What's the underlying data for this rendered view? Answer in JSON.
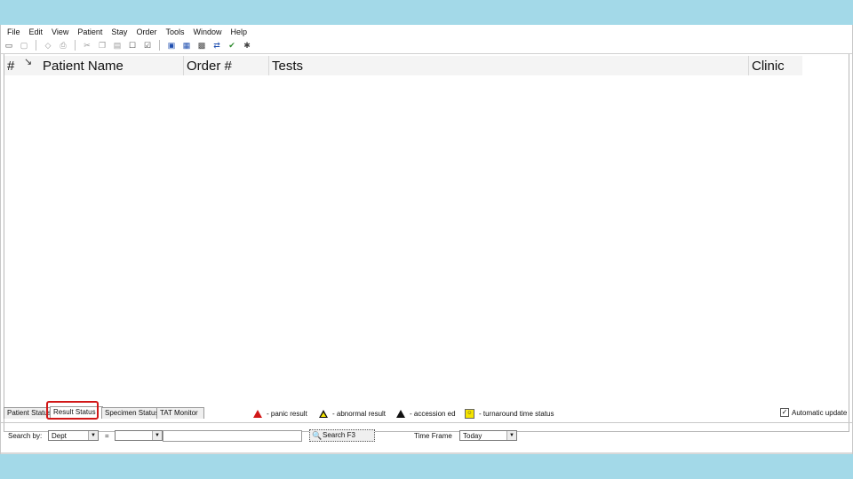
{
  "menu": [
    "File",
    "Edit",
    "View",
    "Patient",
    "Stay",
    "Order",
    "Tools",
    "Window",
    "Help"
  ],
  "toolbar_icons": [
    "open-folder-icon",
    "save-icon",
    "erase-icon",
    "print-icon",
    "cut-icon",
    "copy-icon",
    "paste-icon",
    "properties-icon",
    "check-icon",
    "patient-icon",
    "window-icon",
    "order-icon",
    "transfer-icon",
    "approve-icon",
    "wizard-icon"
  ],
  "columns": {
    "num": "#",
    "patient_name": "Patient Name",
    "order_num": "Order #",
    "tests": "Tests",
    "clinic": "Clinic"
  },
  "tabs": [
    "Patient Status",
    "Result Status",
    "Specimen Status",
    "TAT Monitor"
  ],
  "active_tab": "Result Status",
  "legend": {
    "panic": "- panic result",
    "abnormal": "- abnormal result",
    "accessioned": "- accession ed",
    "turnaround": "- turnaround time status"
  },
  "auto_update": {
    "label": "Automatic update",
    "checked": true
  },
  "search": {
    "search_by_label": "Search by:",
    "search_by_value": "Dept",
    "equals": "=",
    "value_select": "",
    "text": "",
    "button_label": "Search  F3",
    "time_frame_label": "Time Frame",
    "time_frame_value": "Today"
  },
  "colors": {
    "highlight": "#d11818",
    "accent_band": "#a3d9e8"
  }
}
